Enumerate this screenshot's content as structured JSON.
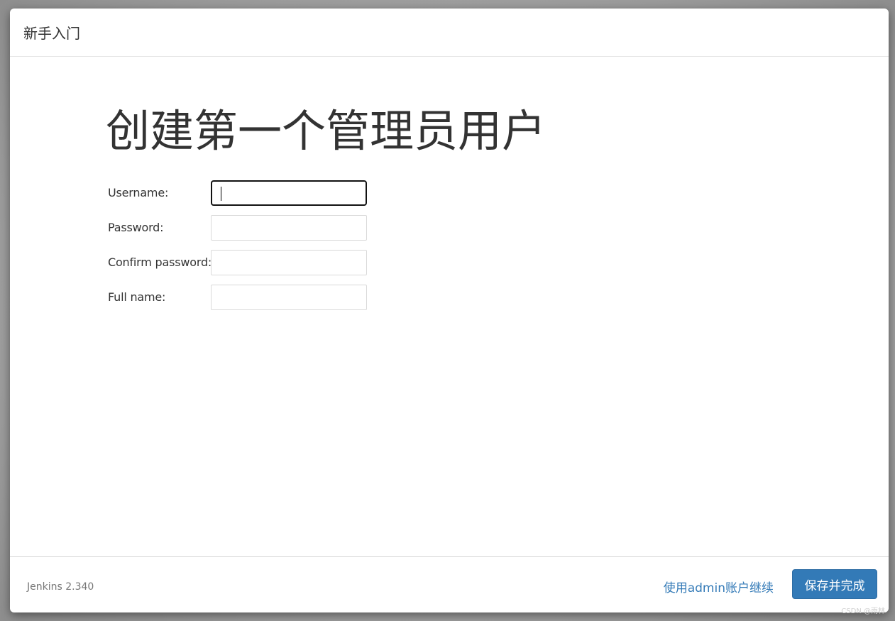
{
  "dialog": {
    "title": "新手入门"
  },
  "main": {
    "heading": "创建第一个管理员用户",
    "fields": [
      {
        "label": "Username:",
        "value": ""
      },
      {
        "label": "Password:",
        "value": ""
      },
      {
        "label": "Confirm password:",
        "value": ""
      },
      {
        "label": "Full name:",
        "value": ""
      }
    ]
  },
  "footer": {
    "version": "Jenkins 2.340",
    "continue_link": "使用admin账户继续",
    "save_button": "保存并完成"
  },
  "watermark": "CSDN @雨林",
  "colors": {
    "primary": "#337ab7",
    "text": "#333333",
    "muted": "#777777"
  }
}
